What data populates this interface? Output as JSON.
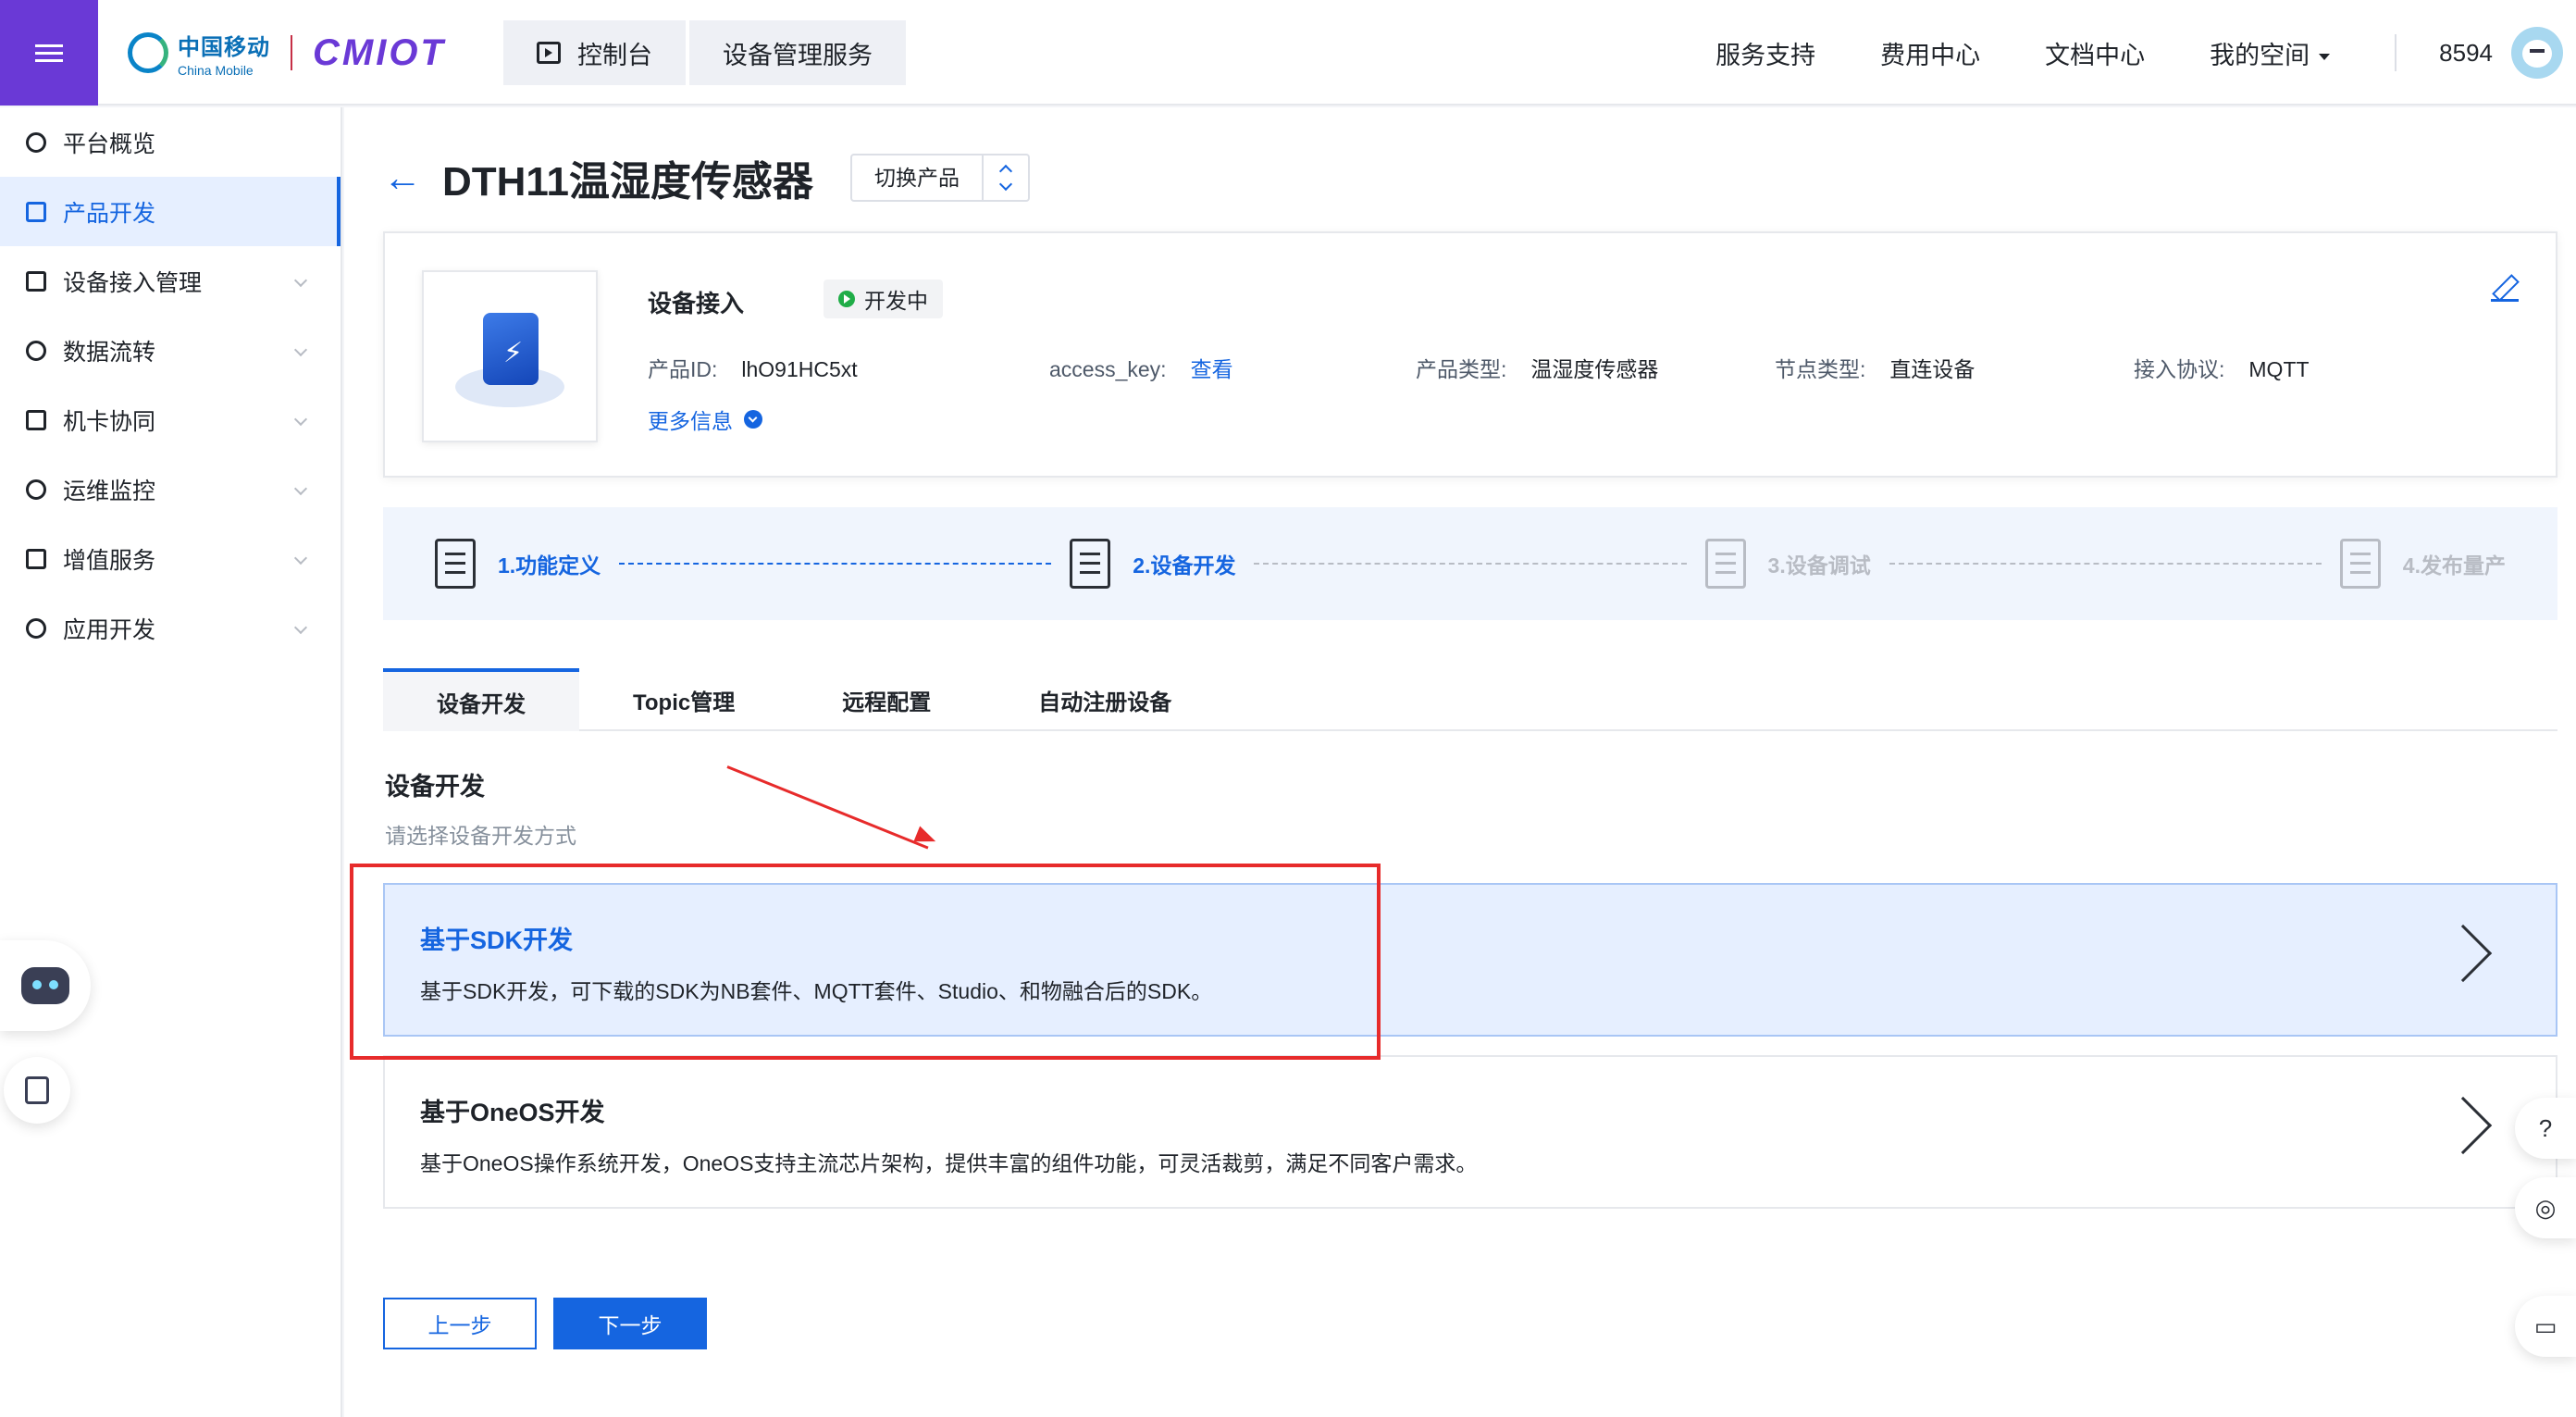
{
  "header": {
    "logo_zh": "中国移动",
    "logo_en": "China Mobile",
    "logo_brand": "CMIOT",
    "breadcrumb": [
      "控制台",
      "设备管理服务"
    ],
    "nav": [
      "服务支持",
      "费用中心",
      "文档中心",
      "我的空间"
    ],
    "user_id": "8594"
  },
  "sidebar": {
    "items": [
      {
        "label": "平台概览",
        "icon": "overview-icon"
      },
      {
        "label": "产品开发",
        "icon": "cube-icon",
        "active": true
      },
      {
        "label": "设备接入管理",
        "icon": "device-icon"
      },
      {
        "label": "数据流转",
        "icon": "flow-icon"
      },
      {
        "label": "机卡协同",
        "icon": "link-icon"
      },
      {
        "label": "运维监控",
        "icon": "monitor-icon"
      },
      {
        "label": "增值服务",
        "icon": "send-icon"
      },
      {
        "label": "应用开发",
        "icon": "app-icon"
      }
    ]
  },
  "page": {
    "title": "DTH11温湿度传感器",
    "switch_label": "切换产品"
  },
  "product": {
    "name": "设备接入",
    "status": "开发中",
    "id_label": "产品ID:",
    "id_value": "lhO91HC5xt",
    "key_label": "access_key:",
    "key_link": "查看",
    "type_label": "产品类型:",
    "type_value": "温湿度传感器",
    "node_label": "节点类型:",
    "node_value": "直连设备",
    "proto_label": "接入协议:",
    "proto_value": "MQTT",
    "more": "更多信息"
  },
  "steps": [
    {
      "label": "1.功能定义",
      "state": "done"
    },
    {
      "label": "2.设备开发",
      "state": "current"
    },
    {
      "label": "3.设备调试",
      "state": "pending"
    },
    {
      "label": "4.发布量产",
      "state": "pending"
    }
  ],
  "tabs": [
    "设备开发",
    "Topic管理",
    "远程配置",
    "自动注册设备"
  ],
  "section": {
    "title": "设备开发",
    "subtitle": "请选择设备开发方式"
  },
  "options": [
    {
      "title": "基于SDK开发",
      "desc": "基于SDK开发，可下载的SDK为NB套件、MQTT套件、Studio、和物融合后的SDK。",
      "selected": true
    },
    {
      "title": "基于OneOS开发",
      "desc": "基于OneOS操作系统开发，OneOS支持主流芯片架构，提供丰富的组件功能，可灵活裁剪，满足不同客户需求。",
      "selected": false
    }
  ],
  "buttons": {
    "prev": "上一步",
    "next": "下一步"
  },
  "colors": {
    "accent": "#1565e0",
    "brand": "#6a39d6",
    "annotation": "#e72b2b",
    "status_ok": "#1fad47"
  }
}
